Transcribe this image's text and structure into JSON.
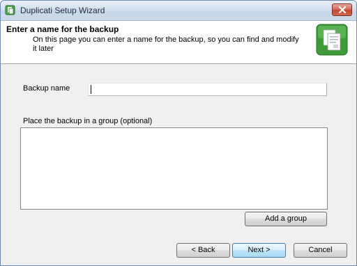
{
  "window": {
    "title": "Duplicati Setup Wizard",
    "icon": "duplicati-app-icon",
    "close_icon": "close-icon",
    "close_color": "#c4442f"
  },
  "header": {
    "title": "Enter a name for the backup",
    "description": "On this page you can enter a name for the backup, so you can find and modify it later",
    "icon": "backup-documents-icon",
    "icon_color": "#3f9b3a"
  },
  "form": {
    "backup_name_label": "Backup name",
    "backup_name_value": "",
    "group_label": "Place the backup in a group (optional)",
    "add_group_label": "Add a group"
  },
  "footer": {
    "back_label": "< Back",
    "next_label": "Next >",
    "cancel_label": "Cancel"
  }
}
